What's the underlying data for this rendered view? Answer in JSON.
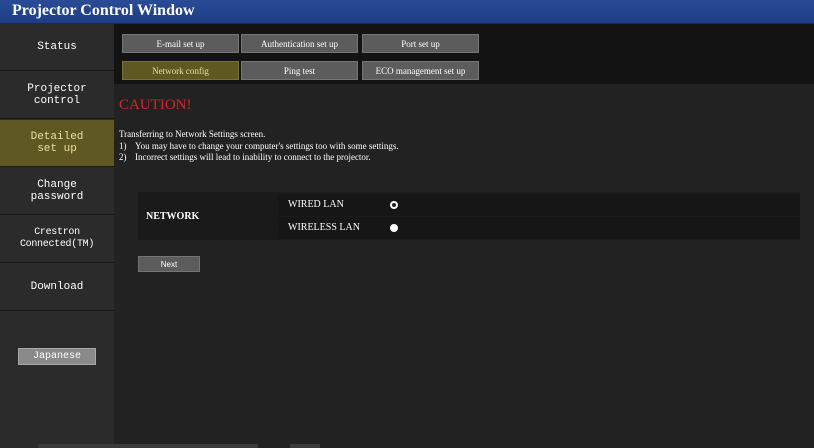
{
  "window": {
    "title": "Projector Control Window"
  },
  "sidebar": {
    "items": [
      {
        "label": "Status",
        "active": false
      },
      {
        "label": "Projector\ncontrol",
        "active": false
      },
      {
        "label": "Detailed\nset up",
        "active": true
      },
      {
        "label": "Change\npassword",
        "active": false
      },
      {
        "label": "Crestron\nConnected(TM)",
        "active": false
      },
      {
        "label": "Download",
        "active": false
      }
    ],
    "language_button": "Japanese"
  },
  "tabs": [
    {
      "label": "E-mail set up",
      "active": false
    },
    {
      "label": "Authentication set up",
      "active": false
    },
    {
      "label": "Port set up",
      "active": false
    },
    {
      "label": "Network config",
      "active": true
    },
    {
      "label": "Ping test",
      "active": false
    },
    {
      "label": "ECO management set up",
      "active": false
    }
  ],
  "main": {
    "caution_title": "CAUTION!",
    "intro": "Transferring to Network Settings screen.",
    "notes": [
      {
        "num": "1)",
        "text": "You may have to change your computer's settings too with some settings."
      },
      {
        "num": "2)",
        "text": "Incorrect settings will lead to inability to connect to the projector."
      }
    ],
    "network": {
      "label": "NETWORK",
      "options": [
        {
          "label": "WIRED LAN",
          "selected": true
        },
        {
          "label": "WIRELESS LAN",
          "selected": false
        }
      ]
    },
    "next_button": "Next"
  },
  "colors": {
    "title_bar": "#1e3d85",
    "active_item": "#5f5823",
    "caution": "#d02828",
    "tab": "#5c5c5c"
  },
  "icons": {
    "radio_selected": "radio-selected-icon",
    "radio_unselected": "radio-unselected-icon"
  }
}
